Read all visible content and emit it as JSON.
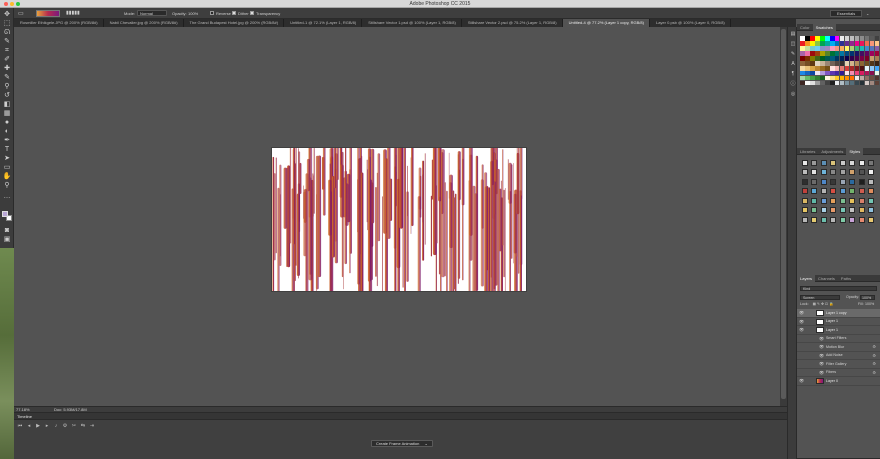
{
  "app": {
    "title": "Adobe Photoshop CC 2015"
  },
  "options_bar": {
    "mode_label": "Mode:",
    "mode_value": "Normal",
    "opacity_label": "Opacity:",
    "opacity_value": "100%",
    "reverse_label": "Reverse",
    "dither_label": "Dither",
    "transparency_label": "Transparency",
    "workspace": "Essentials",
    "gradient_colors": [
      "#e7a23c",
      "#b72a4f",
      "#7c1a7e"
    ]
  },
  "tabs": [
    {
      "label": "Rosmiller Ethikgele.JPG @ 200% (RGB/8#)",
      "active": false
    },
    {
      "label": "Nabil Chevalier.jpg @ 200% (RGB/8#)",
      "active": false
    },
    {
      "label": "The Grand Budapest Hotel.jpg @ 200% (RGB/8#)",
      "active": false
    },
    {
      "label": "Untitled-1 @ 72.1% (Layer 1, RGB/8)",
      "active": false
    },
    {
      "label": "Stillshare Vector 1.psd @ 100% (Layer 1, RGB/8)",
      "active": false
    },
    {
      "label": "Stillshare Vector 2.psd @ 75.2% (Layer 1, RGB/8)",
      "active": false
    },
    {
      "label": "Untitled-4 @ 77.2% (Layer 1 copy, RGB/8)",
      "active": true
    },
    {
      "label": "Layer 0.psb @ 100% (Layer 0, RGB/8)",
      "active": false
    }
  ],
  "status": {
    "zoom": "77.18%",
    "doc": "Doc: 5.93M/17.8M"
  },
  "timeline": {
    "title": "Timeline",
    "create_button": "Create Frame Animation"
  },
  "panels": {
    "swatches": {
      "tabs": [
        "Color",
        "Swatches"
      ],
      "active": "Swatches"
    },
    "styles": {
      "tabs": [
        "Libraries",
        "Adjustments",
        "Styles"
      ],
      "active": "Styles"
    },
    "layers": {
      "tabs": [
        "Layers",
        "Channels",
        "Paths"
      ],
      "active": "Layers",
      "kind": "Kind",
      "blend_mode": "Screen",
      "opacity_label": "Opacity:",
      "opacity_value": "100%",
      "lock_label": "Lock:",
      "fill_label": "Fill:",
      "fill_value": "100%",
      "items": [
        {
          "name": "Layer 1 copy",
          "type": "layer",
          "visible": true,
          "selected": true
        },
        {
          "name": "Layer 1",
          "type": "layer",
          "visible": true,
          "selected": false
        },
        {
          "name": "Layer 1",
          "type": "smart",
          "visible": true,
          "selected": false
        },
        {
          "name": "Smart Filters",
          "type": "filter-group",
          "visible": true,
          "selected": false
        },
        {
          "name": "Motion Blur",
          "type": "filter",
          "visible": true,
          "selected": false
        },
        {
          "name": "Add Noise",
          "type": "filter",
          "visible": true,
          "selected": false
        },
        {
          "name": "Filter Gallery",
          "type": "filter",
          "visible": true,
          "selected": false
        },
        {
          "name": "Fibers",
          "type": "filter",
          "visible": true,
          "selected": false
        },
        {
          "name": "Layer 0",
          "type": "layer",
          "visible": true,
          "selected": false
        }
      ]
    }
  },
  "colors": {
    "foreground": "#b9a7d5",
    "background": "#ffffff",
    "swatches": [
      "#ffffff",
      "#000000",
      "#ff0000",
      "#ffff00",
      "#00ff00",
      "#00ffff",
      "#0000ff",
      "#ff00ff",
      "#ededed",
      "#d6d6d6",
      "#bfbfbf",
      "#a6a6a6",
      "#8c8c8c",
      "#737373",
      "#595959",
      "#404040",
      "#ed1c24",
      "#f7941d",
      "#fff200",
      "#8dc63f",
      "#00a651",
      "#00a99d",
      "#00aeef",
      "#0072bc",
      "#2e3192",
      "#662d91",
      "#92278f",
      "#ec008c",
      "#ed145b",
      "#f26c4f",
      "#f69679",
      "#fdc689",
      "#fff799",
      "#c4df9b",
      "#7accc8",
      "#6dcff6",
      "#8393ca",
      "#a187be",
      "#f49ac1",
      "#f7977a",
      "#fbaf5d",
      "#fff568",
      "#acd373",
      "#3cb878",
      "#1cbbb4",
      "#448ccb",
      "#5674b9",
      "#855fa8",
      "#a864a8",
      "#f06eaa",
      "#9e0b0f",
      "#a0410d",
      "#aba000",
      "#598527",
      "#007236",
      "#00746b",
      "#0076a3",
      "#004a80",
      "#003471",
      "#1b1464",
      "#440e62",
      "#630460",
      "#9e005d",
      "#9e0039",
      "#790000",
      "#7b2e00",
      "#827b00",
      "#406618",
      "#005e20",
      "#005952",
      "#005b7f",
      "#003663",
      "#002157",
      "#0d004c",
      "#32004b",
      "#4b0049",
      "#7b0046",
      "#7a0026",
      "#c69c6d",
      "#a67c52",
      "#8c6239",
      "#754c24",
      "#603913",
      "#e2d4c1",
      "#c7b299",
      "#998675",
      "#736357",
      "#534741",
      "#362f2d",
      "#e6d3b3",
      "#d1b58c",
      "#b38d5a",
      "#8b6535",
      "#6e4c22",
      "#52361a",
      "#3b2414",
      "#f4d8a4",
      "#e8c07a",
      "#d9a648",
      "#b98531",
      "#956a23",
      "#735018",
      "#ffe4e1",
      "#f5b5b0",
      "#e67b74",
      "#d23c3a",
      "#a42728",
      "#7a1b1e",
      "#4f1114",
      "#e3f2fd",
      "#90caf9",
      "#42a5f5",
      "#1e88e5",
      "#1565c0",
      "#0d47a1",
      "#ede7f6",
      "#b39ddb",
      "#7e57c2",
      "#5e35b1",
      "#4527a0",
      "#311b92",
      "#fce4ec",
      "#f48fb1",
      "#ec407a",
      "#d81b60",
      "#ad1457",
      "#880e4f",
      "#e8f5e9",
      "#a5d6a7",
      "#66bb6a",
      "#43a047",
      "#2e7d32",
      "#1b5e20",
      "#fff8e1",
      "#ffe082",
      "#ffca28",
      "#ffb300",
      "#ff8f00",
      "#ff6f00",
      "#efebe9",
      "#bcaaa4",
      "#8d6e63",
      "#6d4c41",
      "#4e342e",
      "#3e2723",
      "#fafafa",
      "#e0e0e0",
      "#9e9e9e",
      "#616161",
      "#424242",
      "#212121",
      "#eceff1",
      "#b0bec5",
      "#78909c",
      "#546e7a",
      "#37474f",
      "#263238",
      "#d7ccc8",
      "#a1887f",
      "#5d4037"
    ],
    "styles": [
      "#e8e8e8",
      "#9a9a9a",
      "#5c8fb5",
      "#d9c37a",
      "#c9c9c9",
      "#d8d8d8",
      "#ececec",
      "#787878",
      "#bcbcbc",
      "#e2e2e2",
      "#6fb4d9",
      "#888888",
      "#a3a3a3",
      "#d1a16b",
      "#545454",
      "#f1f1f1",
      "#2e2e2e",
      "#6b6b6b",
      "#4f87c7",
      "#383838",
      "#9aa6b6",
      "#2a6aa0",
      "#1e1e1e",
      "#bbbbbb",
      "#c0413b",
      "#5ca8d6",
      "#b4b4b4",
      "#d74e43",
      "#5b9bd5",
      "#72b36b",
      "#cf5c4f",
      "#e08c5d",
      "#d9b662",
      "#5fb8a7",
      "#6a9ed8",
      "#e6a05b",
      "#7bbf91",
      "#e6c15a",
      "#d8806a",
      "#73c5b3",
      "#e7c765",
      "#79c093",
      "#a8d0e6",
      "#e89a6b",
      "#76c5b5",
      "#c3c3c3",
      "#e0b860",
      "#8ec1dd",
      "#b8b8b8",
      "#e5cc72",
      "#6dbfae",
      "#b7b7b7",
      "#7fcaa6",
      "#c8a2d8",
      "#e68a6f",
      "#e9c870"
    ]
  }
}
